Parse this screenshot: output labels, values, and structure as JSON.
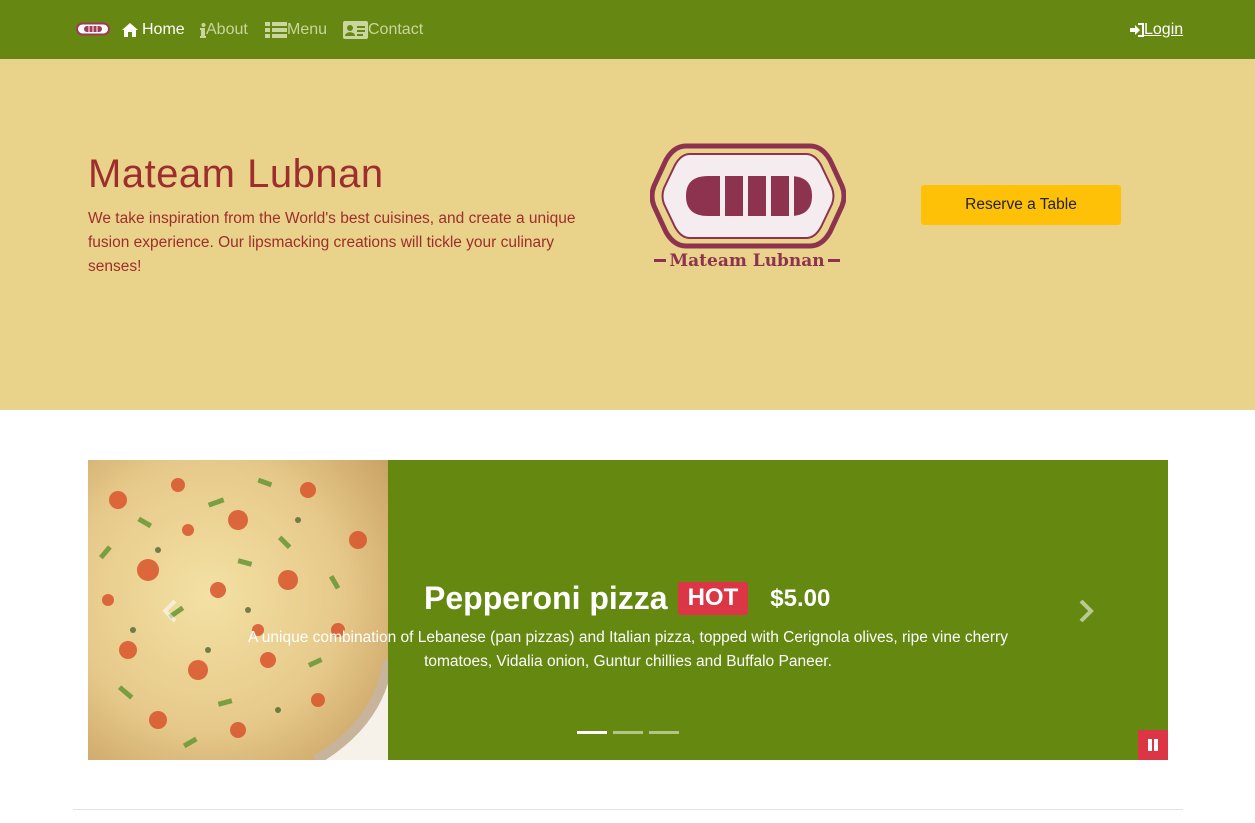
{
  "nav": {
    "brand_icon": "sandwich-logo-icon",
    "items": [
      {
        "label": "Home",
        "icon": "home-icon",
        "active": true
      },
      {
        "label": "About",
        "icon": "info-icon",
        "active": false
      },
      {
        "label": "Menu",
        "icon": "list-icon",
        "active": false
      },
      {
        "label": "Contact",
        "icon": "address-card-icon",
        "active": false
      }
    ],
    "login": {
      "label": "Login",
      "icon": "sign-in-icon"
    }
  },
  "hero": {
    "title": "Mateam Lubnan",
    "description": "We take inspiration from the World's best cuisines, and create a unique fusion experience. Our lipsmacking creations will tickle your culinary senses!",
    "logo_text": "Mateam Lubnan",
    "reserve_label": "Reserve a Table"
  },
  "carousel": {
    "slide": {
      "name": "Pepperoni pizza",
      "badge": "HOT",
      "price": "$5.00",
      "description": "A unique combination of Lebanese (pan pizzas) and Italian pizza, topped with Cerignola olives, ripe vine cherry tomatoes, Vidalia onion, Guntur chillies and Buffalo Paneer."
    },
    "indicators": [
      true,
      false,
      false
    ]
  },
  "colors": {
    "navbar": "#668711",
    "jumbotron": "#e9d38b",
    "hero_text": "#9e2d2d",
    "reserve_button": "#ffc107",
    "carousel_bg": "#648810",
    "badge": "#dc3545",
    "logo": "#8d3350"
  }
}
